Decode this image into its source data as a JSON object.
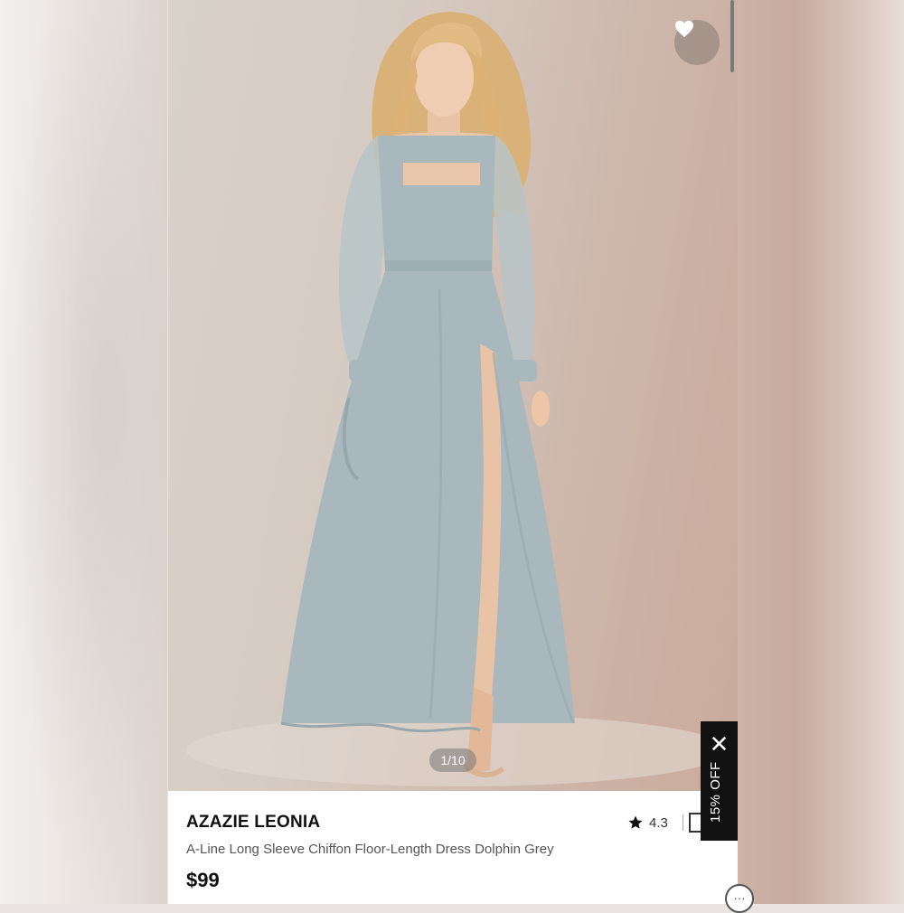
{
  "product": {
    "brand": "AZAZIE LEONIA",
    "title": "A-Line Long Sleeve Chiffon Floor-Length Dress Dolphin Grey",
    "price": "$99",
    "rating": "4.3"
  },
  "gallery": {
    "counter": "1/10"
  },
  "promo": {
    "label": "15% OFF"
  },
  "icons": {
    "favorite": "heart-icon",
    "rating": "star-icon",
    "close": "close-icon",
    "chat": "chat-icon"
  },
  "colors": {
    "dress": "#a9b8bd",
    "promo_bg": "#111111",
    "price": "#111111"
  }
}
